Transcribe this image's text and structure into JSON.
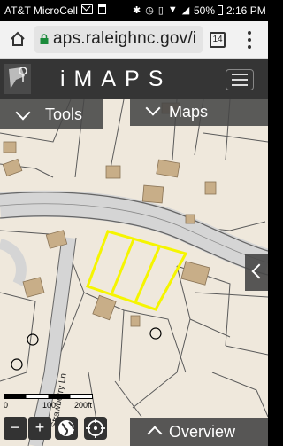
{
  "status_bar": {
    "carrier": "AT&T MicroCell",
    "battery_pct": "50%",
    "time": "2:16 PM",
    "icons": [
      "mail-icon",
      "trash-icon",
      "bluetooth-icon",
      "alarm-icon",
      "vibrate-icon",
      "wifi-icon",
      "signal-icon",
      "battery-icon"
    ]
  },
  "browser": {
    "url": "aps.raleighnc.gov/i",
    "tab_count": "14"
  },
  "app": {
    "title": "iMAPS"
  },
  "panels": {
    "tools_label": "Tools",
    "maps_label": "Maps",
    "overview_label": "Overview"
  },
  "map": {
    "street_label": "Strawberry Ln",
    "scale": {
      "labels": [
        "0",
        "100",
        "200ft"
      ]
    },
    "controls": {
      "zoom_out": "−",
      "zoom_in": "+"
    },
    "colors": {
      "selection": "#f5f500",
      "parcel_line": "#555555",
      "road": "#d0d0d0",
      "building": "#c8ae88",
      "background": "#efe8dc"
    }
  }
}
